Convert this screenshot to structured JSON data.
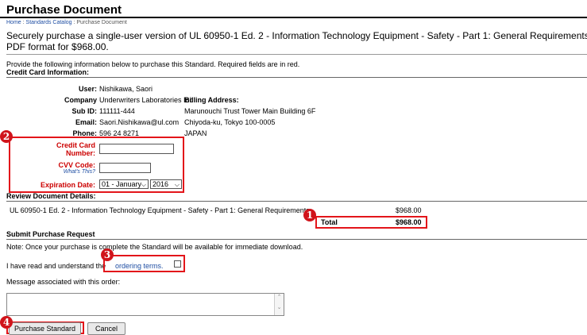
{
  "page": {
    "title": "Purchase Document",
    "breadcrumb": [
      "Home",
      "Standards Catalog",
      "Purchase Document"
    ],
    "breadcrumb_sep": ":",
    "intro_line1": "Securely purchase a single-user version of UL 60950-1 Ed. 2 - Information Technology Equipment - Safety - Part 1: General Requirements i",
    "intro_line2": "PDF format for $968.00.",
    "instructions": "Provide the following information below to purchase this Standard. Required fields are in red."
  },
  "credit_card": {
    "heading": "Credit Card Information:",
    "user_label": "User:",
    "user_value": "Nishikawa, Saori",
    "company_label": "Company",
    "company_value": "Underwriters Laboratories Inc",
    "subid_label": "Sub ID:",
    "subid_value": "111111-444",
    "email_label": "Email:",
    "email_value": "Saori.Nishikawa@ul.com",
    "phone_label": "Phone:",
    "phone_value": "596 24 8271",
    "billing_heading": "Billing Address:",
    "billing_lines": [
      "Marunouchi Trust Tower Main Building 6F",
      "Chiyoda-ku, Tokyo 100-0005",
      "JAPAN"
    ],
    "cc_number_label_1": "Credit Card",
    "cc_number_label_2": "Number:",
    "cvv_label": "CVV Code:",
    "whats_this": "What's This?",
    "expiration_label": "Expiration Date:",
    "exp_month": "01 - January",
    "exp_year": "2016"
  },
  "review": {
    "heading": "Review Document Details:",
    "item_name": "UL 60950-1 Ed. 2 - Information Technology Equipment - Safety - Part 1: General Requirements",
    "item_price": "$968.00",
    "total_label": "Total",
    "total_price": "$968.00"
  },
  "submit": {
    "heading": "Submit Purchase Request",
    "note": "Note: Once your purchase is complete the Standard will be available for immediate download.",
    "terms_prefix": "I have read and understand the",
    "terms_link": "ordering terms.",
    "message_label": "Message associated with this order:",
    "purchase_button": "Purchase Standard",
    "cancel_button": "Cancel"
  },
  "annotations": [
    "1",
    "2",
    "3",
    "4"
  ],
  "colors": {
    "annotation_red": "#e3151a",
    "required_red": "#cc0000",
    "link_blue": "#1f4ea3"
  }
}
